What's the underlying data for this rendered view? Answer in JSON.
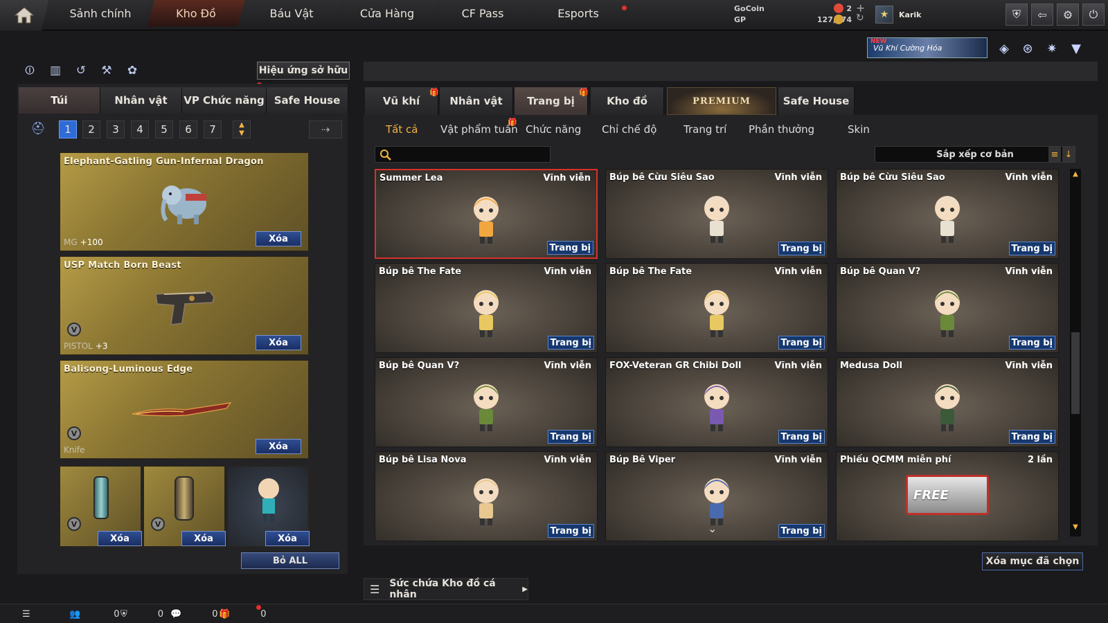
{
  "nav": {
    "tabs": [
      "Sảnh chính",
      "Kho Đồ",
      "Báu Vật",
      "Cửa Hàng",
      "CF Pass",
      "Esports"
    ],
    "active": "Kho Đồ"
  },
  "currency": {
    "gocoin_label": "GoCoin",
    "gocoin_value": "2",
    "gp_label": "GP",
    "gp_value": "127,374"
  },
  "profile": {
    "name": "Karik"
  },
  "banner": {
    "new": "NEW",
    "text": "Vũ Khí Cường Hóa"
  },
  "left": {
    "effect_button": "Hiệu ứng sở hữu",
    "tabs": [
      "Túi",
      "Nhân vật",
      "VP Chức năng",
      "Safe House"
    ],
    "pages": [
      "1",
      "2",
      "3",
      "4",
      "5",
      "6",
      "7"
    ],
    "cards": [
      {
        "name": "Elephant-Gatling Gun-Infernal Dragon",
        "category": "MG",
        "level": "+100",
        "delete": "Xóa"
      },
      {
        "name": "USP Match Born Beast",
        "category": "PISTOL",
        "level": "+3",
        "delete": "Xóa"
      },
      {
        "name": "Balisong-Luminous Edge",
        "category": "Knife",
        "level": "",
        "delete": "Xóa"
      }
    ],
    "slots": [
      {
        "delete": "Xóa"
      },
      {
        "delete": "Xóa"
      },
      {
        "delete": "Xóa"
      }
    ],
    "remove_all": "Bỏ ALL"
  },
  "right": {
    "tabs": [
      "Vũ khí",
      "Nhân vật",
      "Trang bị",
      "Kho đồ",
      "PREMIUM",
      "Safe House"
    ],
    "subtabs": [
      "Tất cả",
      "Vật phẩm tuần",
      "Chức năng",
      "Chỉ chế độ",
      "Trang trí",
      "Phần thưởng",
      "Skin"
    ],
    "sort_label": "Sắp xếp cơ bản",
    "items": [
      {
        "name": "Summer Lea",
        "duration": "Vĩnh viễn",
        "action": "Trang bị",
        "selected": true
      },
      {
        "name": "Búp bê Cừu Siêu Sao",
        "duration": "Vĩnh viễn",
        "action": "Trang bị"
      },
      {
        "name": "Búp bê Cừu Siêu Sao",
        "duration": "Vĩnh viễn",
        "action": "Trang bị"
      },
      {
        "name": "Búp bê The Fate",
        "duration": "Vĩnh viễn",
        "action": "Trang bị"
      },
      {
        "name": "Búp bê The Fate",
        "duration": "Vĩnh viễn",
        "action": "Trang bị"
      },
      {
        "name": "Búp bê Quan V?",
        "duration": "Vĩnh viễn",
        "action": "Trang bị"
      },
      {
        "name": "Búp bê Quan V?",
        "duration": "Vĩnh viễn",
        "action": "Trang bị"
      },
      {
        "name": "FOX-Veteran GR Chibi Doll",
        "duration": "Vĩnh viễn",
        "action": "Trang bị"
      },
      {
        "name": "Medusa Doll",
        "duration": "Vĩnh viễn",
        "action": "Trang bị"
      },
      {
        "name": "Búp bê Lisa Nova",
        "duration": "Vĩnh viễn",
        "action": "Trang bị"
      },
      {
        "name": "Búp Bê Viper",
        "duration": "Vĩnh viễn",
        "action": "Trang bị"
      },
      {
        "name": "Phiếu QCMM miễn phí",
        "duration": "2 lần",
        "action": "",
        "badge": "FREE"
      }
    ],
    "delete_selected": "Xóa mục đã chọn",
    "capacity_label": "Sức chứa Kho đồ cá nhân"
  },
  "bottom": {
    "counts": [
      "0",
      "0",
      "0",
      "0"
    ]
  },
  "colors": {
    "accent": "#f5b340",
    "select": "#d8312a",
    "button": "#1b2f63",
    "active_page": "#2f6bd6"
  }
}
